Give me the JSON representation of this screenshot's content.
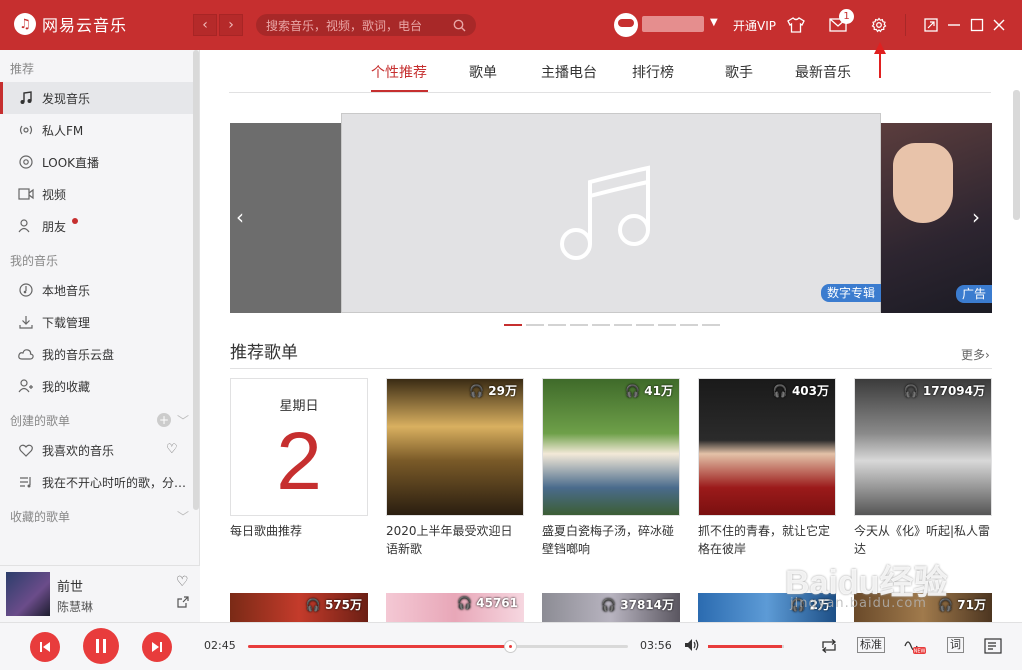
{
  "app": {
    "title": "网易云音乐",
    "logo_glyph": "♫"
  },
  "header": {
    "search_placeholder": "搜索音乐，视频，歌词，电台",
    "vip_label": "开通VIP",
    "mail_badge": "1",
    "back_glyph": "‹",
    "forward_glyph": "›"
  },
  "sidebar": {
    "sections": [
      {
        "title": "推荐",
        "items": [
          {
            "label": "发现音乐",
            "icon": "music-note-icon"
          },
          {
            "label": "私人FM",
            "icon": "radio-icon"
          },
          {
            "label": "LOOK直播",
            "icon": "live-icon"
          },
          {
            "label": "视频",
            "icon": "video-icon"
          },
          {
            "label": "朋友",
            "icon": "friends-icon"
          }
        ]
      },
      {
        "title": "我的音乐",
        "items": [
          {
            "label": "本地音乐",
            "icon": "disc-icon"
          },
          {
            "label": "下载管理",
            "icon": "download-icon"
          },
          {
            "label": "我的音乐云盘",
            "icon": "cloud-icon"
          },
          {
            "label": "我的收藏",
            "icon": "collection-icon"
          }
        ]
      },
      {
        "title": "创建的歌单",
        "items": [
          {
            "label": "我喜欢的音乐",
            "icon": "heart-icon"
          },
          {
            "label": "我在不开心时听的歌，分…",
            "icon": "playlist-icon"
          }
        ]
      },
      {
        "title": "收藏的歌单",
        "items": []
      }
    ]
  },
  "now_playing": {
    "title": "前世",
    "artist": "陈慧琳",
    "current": "02:45",
    "total": "03:56",
    "progress": 0.69,
    "volume": 0.98
  },
  "tabs": [
    "个性推荐",
    "歌单",
    "主播电台",
    "排行榜",
    "歌手",
    "最新音乐"
  ],
  "banner": {
    "tag_center": "数字专辑",
    "tag_right": "广告",
    "dots": 10,
    "active_dot": 0
  },
  "recommend": {
    "title": "推荐歌单",
    "more": "更多›",
    "daily": {
      "weekday": "星期日",
      "day": "2",
      "name": "每日歌曲推荐"
    },
    "playlists": [
      {
        "count": "29万",
        "name": "2020上半年最受欢迎日语新歌"
      },
      {
        "count": "41万",
        "name": "盛夏白瓷梅子汤，碎冰碰壁铛啷响"
      },
      {
        "count": "403万",
        "name": "抓不住的青春，就让它定格在彼岸"
      },
      {
        "count": "177094万",
        "name": "今天从《化》听起|私人雷达"
      }
    ],
    "row2": [
      {
        "count": "575万"
      },
      {
        "count": "45761"
      },
      {
        "count": "37814万"
      },
      {
        "count": "2万"
      },
      {
        "count": "71万"
      }
    ]
  },
  "player": {
    "quality": "标准",
    "lyric": "词"
  },
  "watermark": {
    "main": "Baidu经验",
    "sub": "jingyan.baidu.com"
  },
  "colors": {
    "brand": "#c62f2f",
    "accent": "#e83c3c",
    "tag": "#3b7ccf"
  }
}
